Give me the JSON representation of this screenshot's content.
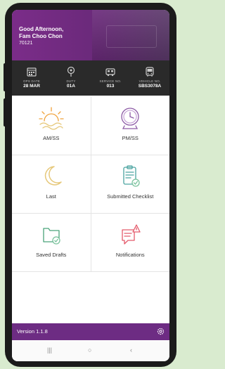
{
  "header": {
    "greeting_line1": "Good Afternoon,",
    "greeting_line2": "Fam Choo Chon",
    "user_id": "70121"
  },
  "info_bar": [
    {
      "icon": "calendar-icon",
      "label": "OPS DATE",
      "value": "28 MAR"
    },
    {
      "icon": "pin-icon",
      "label": "DUTY",
      "value": "01A"
    },
    {
      "icon": "bus-icon",
      "label": "SERVICE NO.",
      "value": "013"
    },
    {
      "icon": "bus-front-icon",
      "label": "VEHICLE NO.",
      "value": "SBS3078A"
    }
  ],
  "tiles": [
    {
      "name": "am-ss",
      "icon": "sunrise-icon",
      "label": "AM/SS"
    },
    {
      "name": "pm-ss",
      "icon": "clock-icon",
      "label": "PM/SS"
    },
    {
      "name": "last",
      "icon": "moon-icon",
      "label": "Last"
    },
    {
      "name": "submitted-checklist",
      "icon": "checklist-icon",
      "label": "Submitted Checklist"
    },
    {
      "name": "saved-drafts",
      "icon": "folder-icon",
      "label": "Saved Drafts"
    },
    {
      "name": "notifications",
      "icon": "notification-icon",
      "label": "Notifications"
    }
  ],
  "footer": {
    "version": "Version 1.1.8",
    "settings_icon": "gear-icon"
  },
  "navbar": [
    {
      "icon": "recent-apps-icon",
      "glyph": "|||"
    },
    {
      "icon": "home-icon",
      "glyph": "○"
    },
    {
      "icon": "back-icon",
      "glyph": "‹"
    }
  ],
  "colors": {
    "header": "#7b2c89",
    "footer": "#6d2c83",
    "info_bar": "#2a2a2a",
    "icon_orange": "#f0a23b",
    "icon_purple": "#8d5ba6",
    "icon_yellow": "#e6c87a",
    "icon_green": "#79c29c",
    "icon_red": "#e45a6b"
  }
}
